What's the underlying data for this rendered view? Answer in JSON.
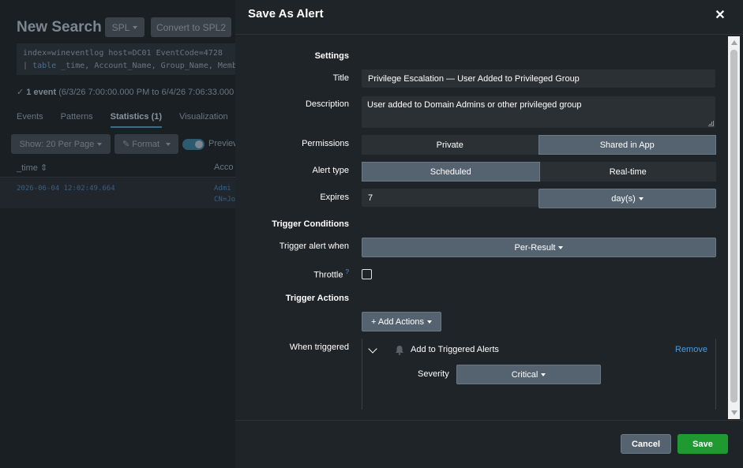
{
  "background": {
    "title": "New Search",
    "spl_button": "SPL",
    "convert_button": "Convert to SPL2",
    "query_line1": "index=wineventlog host=DC01 EventCode=4728",
    "query_line2_pipe": "|",
    "query_line2_cmd": "table",
    "query_line2_rest": "_time, Account_Name, Group_Name, Member_",
    "events_count": "1 event",
    "events_range": "(6/3/26 7:00:00.000 PM to 6/4/26 7:06:33.000",
    "tabs": [
      "Events",
      "Patterns",
      "Statistics (1)",
      "Visualization"
    ],
    "per_page": "Show: 20 Per Page",
    "format": "Format",
    "preview": "Preview",
    "col_time": "_time",
    "col_account": "Acco",
    "row_time": "2026-06-04 12:02:49.664",
    "row_account_1": "Admi",
    "row_account_2": "CN=Jo"
  },
  "modal": {
    "title": "Save As Alert",
    "close_icon": "close-icon",
    "settings_header": "Settings",
    "title_label": "Title",
    "title_value": "Privilege Escalation — User Added to Privileged Group",
    "description_label": "Description",
    "description_value": "User added to Domain Admins or other privileged group",
    "permissions_label": "Permissions",
    "permissions_options": [
      "Private",
      "Shared in App"
    ],
    "permissions_selected": "Shared in App",
    "alert_type_label": "Alert type",
    "alert_type_options": [
      "Scheduled",
      "Real-time"
    ],
    "alert_type_selected": "Scheduled",
    "expires_label": "Expires",
    "expires_value": "7",
    "expires_unit": "day(s)",
    "trigger_conditions_header": "Trigger Conditions",
    "trigger_when_label": "Trigger alert when",
    "trigger_when_value": "Per-Result",
    "throttle_label": "Throttle",
    "throttle_help": "?",
    "throttle_checked": false,
    "trigger_actions_header": "Trigger Actions",
    "add_actions_button": "+ Add Actions",
    "when_triggered_label": "When triggered",
    "action_name": "Add to Triggered Alerts",
    "action_icon": "bell-icon",
    "remove_link": "Remove",
    "severity_label": "Severity",
    "severity_value": "Critical",
    "cancel_button": "Cancel",
    "save_button": "Save"
  },
  "colors": {
    "save_green": "#1f9a31",
    "link_blue": "#4a9ce0",
    "selected_segment": "#556370"
  }
}
